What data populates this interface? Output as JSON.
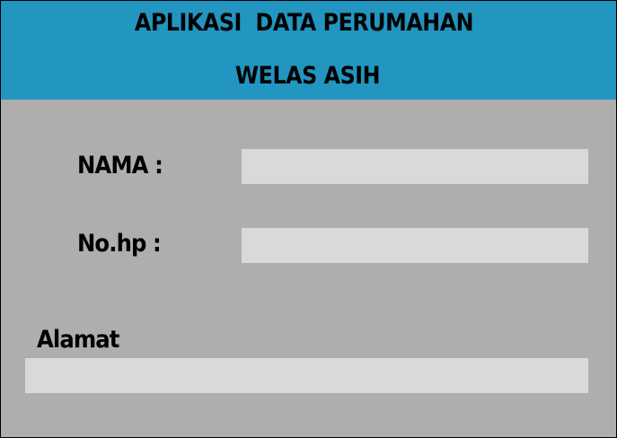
{
  "header": {
    "title_line_1": "APLIKASI  DATA PERUMAHAN",
    "title_line_2": "WELAS ASIH"
  },
  "form": {
    "nama": {
      "label": "NAMA :",
      "value": ""
    },
    "nohp": {
      "label": "No.hp :",
      "value": ""
    },
    "alamat": {
      "label": "Alamat",
      "value": ""
    }
  },
  "colors": {
    "header_background": "#2295c0",
    "body_background": "#afaeac",
    "input_background": "#d9d9d9",
    "text": "#000000"
  }
}
